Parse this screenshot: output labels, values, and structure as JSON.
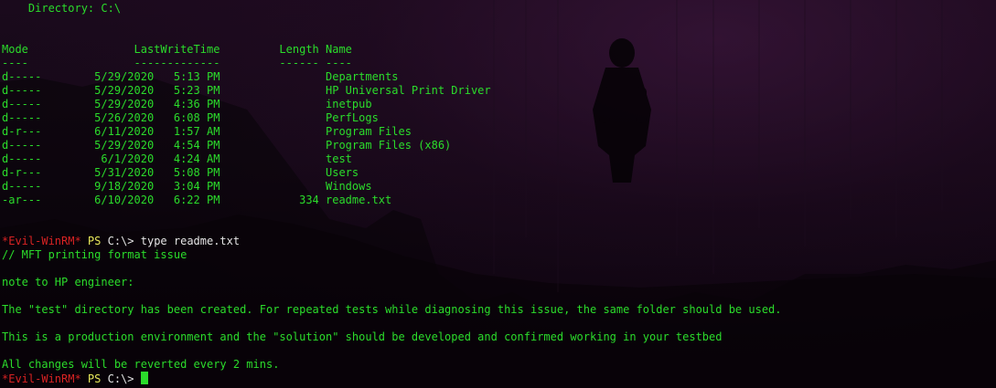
{
  "terminal": {
    "directory_header": "    Directory: C:\\",
    "table_header": "Mode                LastWriteTime         Length Name",
    "table_separator": "----                -------------         ------ ----",
    "rows": [
      "d-----        5/29/2020   5:13 PM                Departments",
      "d-----        5/29/2020   5:23 PM                HP Universal Print Driver",
      "d-----        5/29/2020   4:36 PM                inetpub",
      "d-----        5/26/2020   6:08 PM                PerfLogs",
      "d-r---        6/11/2020   1:57 AM                Program Files",
      "d-----        5/29/2020   4:54 PM                Program Files (x86)",
      "d-----         6/1/2020   4:24 AM                test",
      "d-r---        5/31/2020   5:08 PM                Users",
      "d-----        9/18/2020   3:04 PM                Windows",
      "-ar---        6/10/2020   6:22 PM            334 readme.txt"
    ],
    "prompt": {
      "tag": "*Evil-WinRM*",
      "ps": " PS",
      "path": " C:\\>",
      "command": " type readme.txt"
    },
    "readme": {
      "line1": "// MFT printing format issue",
      "line2": "note to HP engineer:",
      "line3": "The \"test\" directory has been created. For repeated tests while diagnosing this issue, the same folder should be used.",
      "line4": "This is a production environment and the \"solution\" should be developed and confirmed working in your testbed",
      "line5": "All changes will be reverted every 2 mins."
    },
    "final_prompt": {
      "tag": "*Evil-WinRM*",
      "ps": " PS",
      "path": " C:\\> "
    }
  },
  "colors": {
    "output_green": "#2bdc2b",
    "prompt_red": "#d92323",
    "ps_yellow": "#e8e85a",
    "path_white": "#e4e4e4",
    "background": "#140816"
  }
}
